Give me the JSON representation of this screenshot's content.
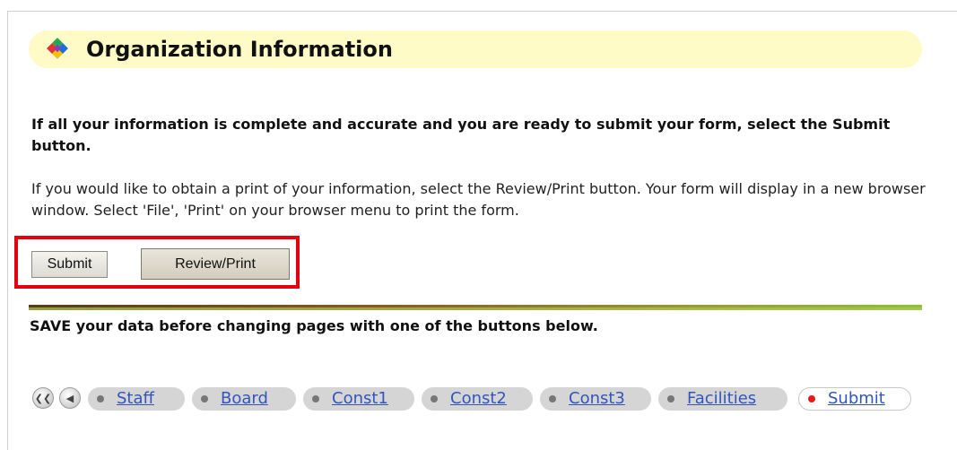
{
  "header": {
    "title": "Organization Information",
    "icon": "diamond-logo-icon"
  },
  "intro": {
    "bold_text": "If all your information is complete and accurate and you are ready to submit your form, select the Submit button.",
    "text": "If you would like to obtain a print of your information, select the Review/Print button. Your form will display in a new browser window. Select 'File', 'Print' on your browser menu to print the form."
  },
  "actions": {
    "submit_label": "Submit",
    "review_label": "Review/Print",
    "highlight_color": "#e3000f"
  },
  "save_note": "SAVE your data before changing pages with one of the buttons below.",
  "nav": {
    "first_icon": "double-chevron-left-icon",
    "prev_icon": "chevron-left-icon",
    "items": [
      {
        "label": "Staff"
      },
      {
        "label": "Board"
      },
      {
        "label": "Const1"
      },
      {
        "label": "Const2"
      },
      {
        "label": "Const3"
      },
      {
        "label": "Facilities"
      },
      {
        "label": "Submit",
        "active": true
      }
    ]
  }
}
